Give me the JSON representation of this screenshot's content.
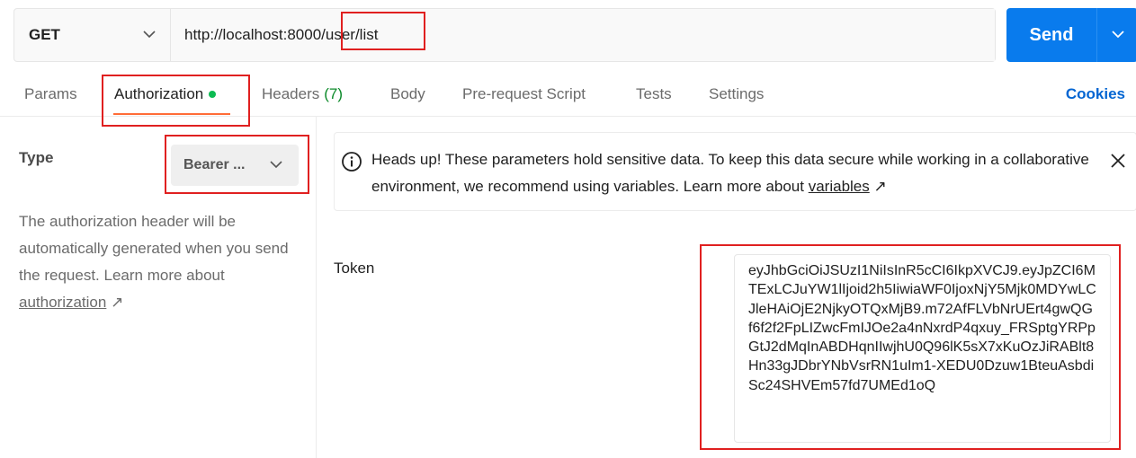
{
  "request": {
    "method": "GET",
    "url": "http://localhost:8000/user/list",
    "send_label": "Send"
  },
  "tabs": [
    {
      "label": "Params"
    },
    {
      "label": "Authorization"
    },
    {
      "label": "Headers",
      "count": "(7)"
    },
    {
      "label": "Body"
    },
    {
      "label": "Pre-request Script"
    },
    {
      "label": "Tests"
    },
    {
      "label": "Settings"
    }
  ],
  "cookies_label": "Cookies",
  "auth": {
    "type_label": "Type",
    "type_value": "Bearer ...",
    "desc_text": "The authorization header will be automatically generated when you send the request. Learn more about",
    "desc_link": "authorization",
    "arrow": "↗"
  },
  "alert": {
    "text": "Heads up! These parameters hold sensitive data. To keep this data secure while working in a collaborative environment, we recommend using variables. Learn more about",
    "link": "variables",
    "arrow": "↗"
  },
  "token": {
    "label": "Token",
    "value": "eyJhbGciOiJSUzI1NiIsInR5cCI6IkpXVCJ9.eyJpZCI6MTExLCJuYW1lIjoid2h5IiwiaWF0IjoxNjY5Mjk0MDYwLCJleHAiOjE2NjkyOTQxMjB9.m72AfFLVbNrUErt4gwQGf6f2f2FpLIZwcFmIJOe2a4nNxrdP4qxuy_FRSptgYRPpGtJ2dMqInABDHqnIIwjhU0Q96lK5sX7xKuOzJiRABlt8Hn33gJDbrYNbVsrRN1uIm1-XEDU0Dzuw1BteuAsbdiSc24SHVEm57fd7UMEd1oQ"
  },
  "colors": {
    "accent_orange": "#ff6c37",
    "send_blue": "#097bed",
    "link_blue": "#0265d2",
    "status_green": "#0cbb52",
    "highlight_red": "#e02020"
  }
}
